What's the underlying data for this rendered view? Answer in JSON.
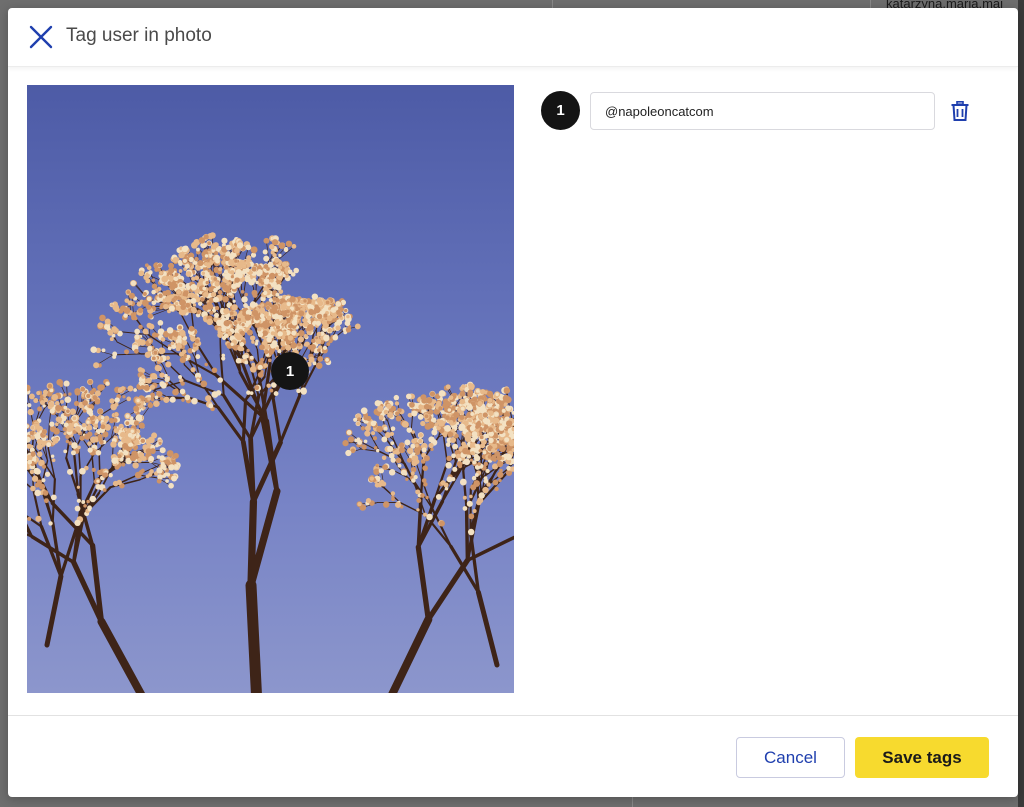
{
  "background": {
    "username": "katarzyna.maria.maj"
  },
  "modal": {
    "title": "Tag user in photo",
    "close_icon": "close-icon"
  },
  "photo": {
    "description_icon": "photo",
    "markers": [
      {
        "number": "1"
      }
    ]
  },
  "tags": [
    {
      "number": "1",
      "value": "@napoleoncatcom",
      "delete_icon": "trash-icon"
    }
  ],
  "footer": {
    "cancel_label": "Cancel",
    "save_label": "Save tags"
  },
  "colors": {
    "accent": "#1f3fae",
    "save_button": "#f7da2e",
    "marker": "#141414"
  }
}
